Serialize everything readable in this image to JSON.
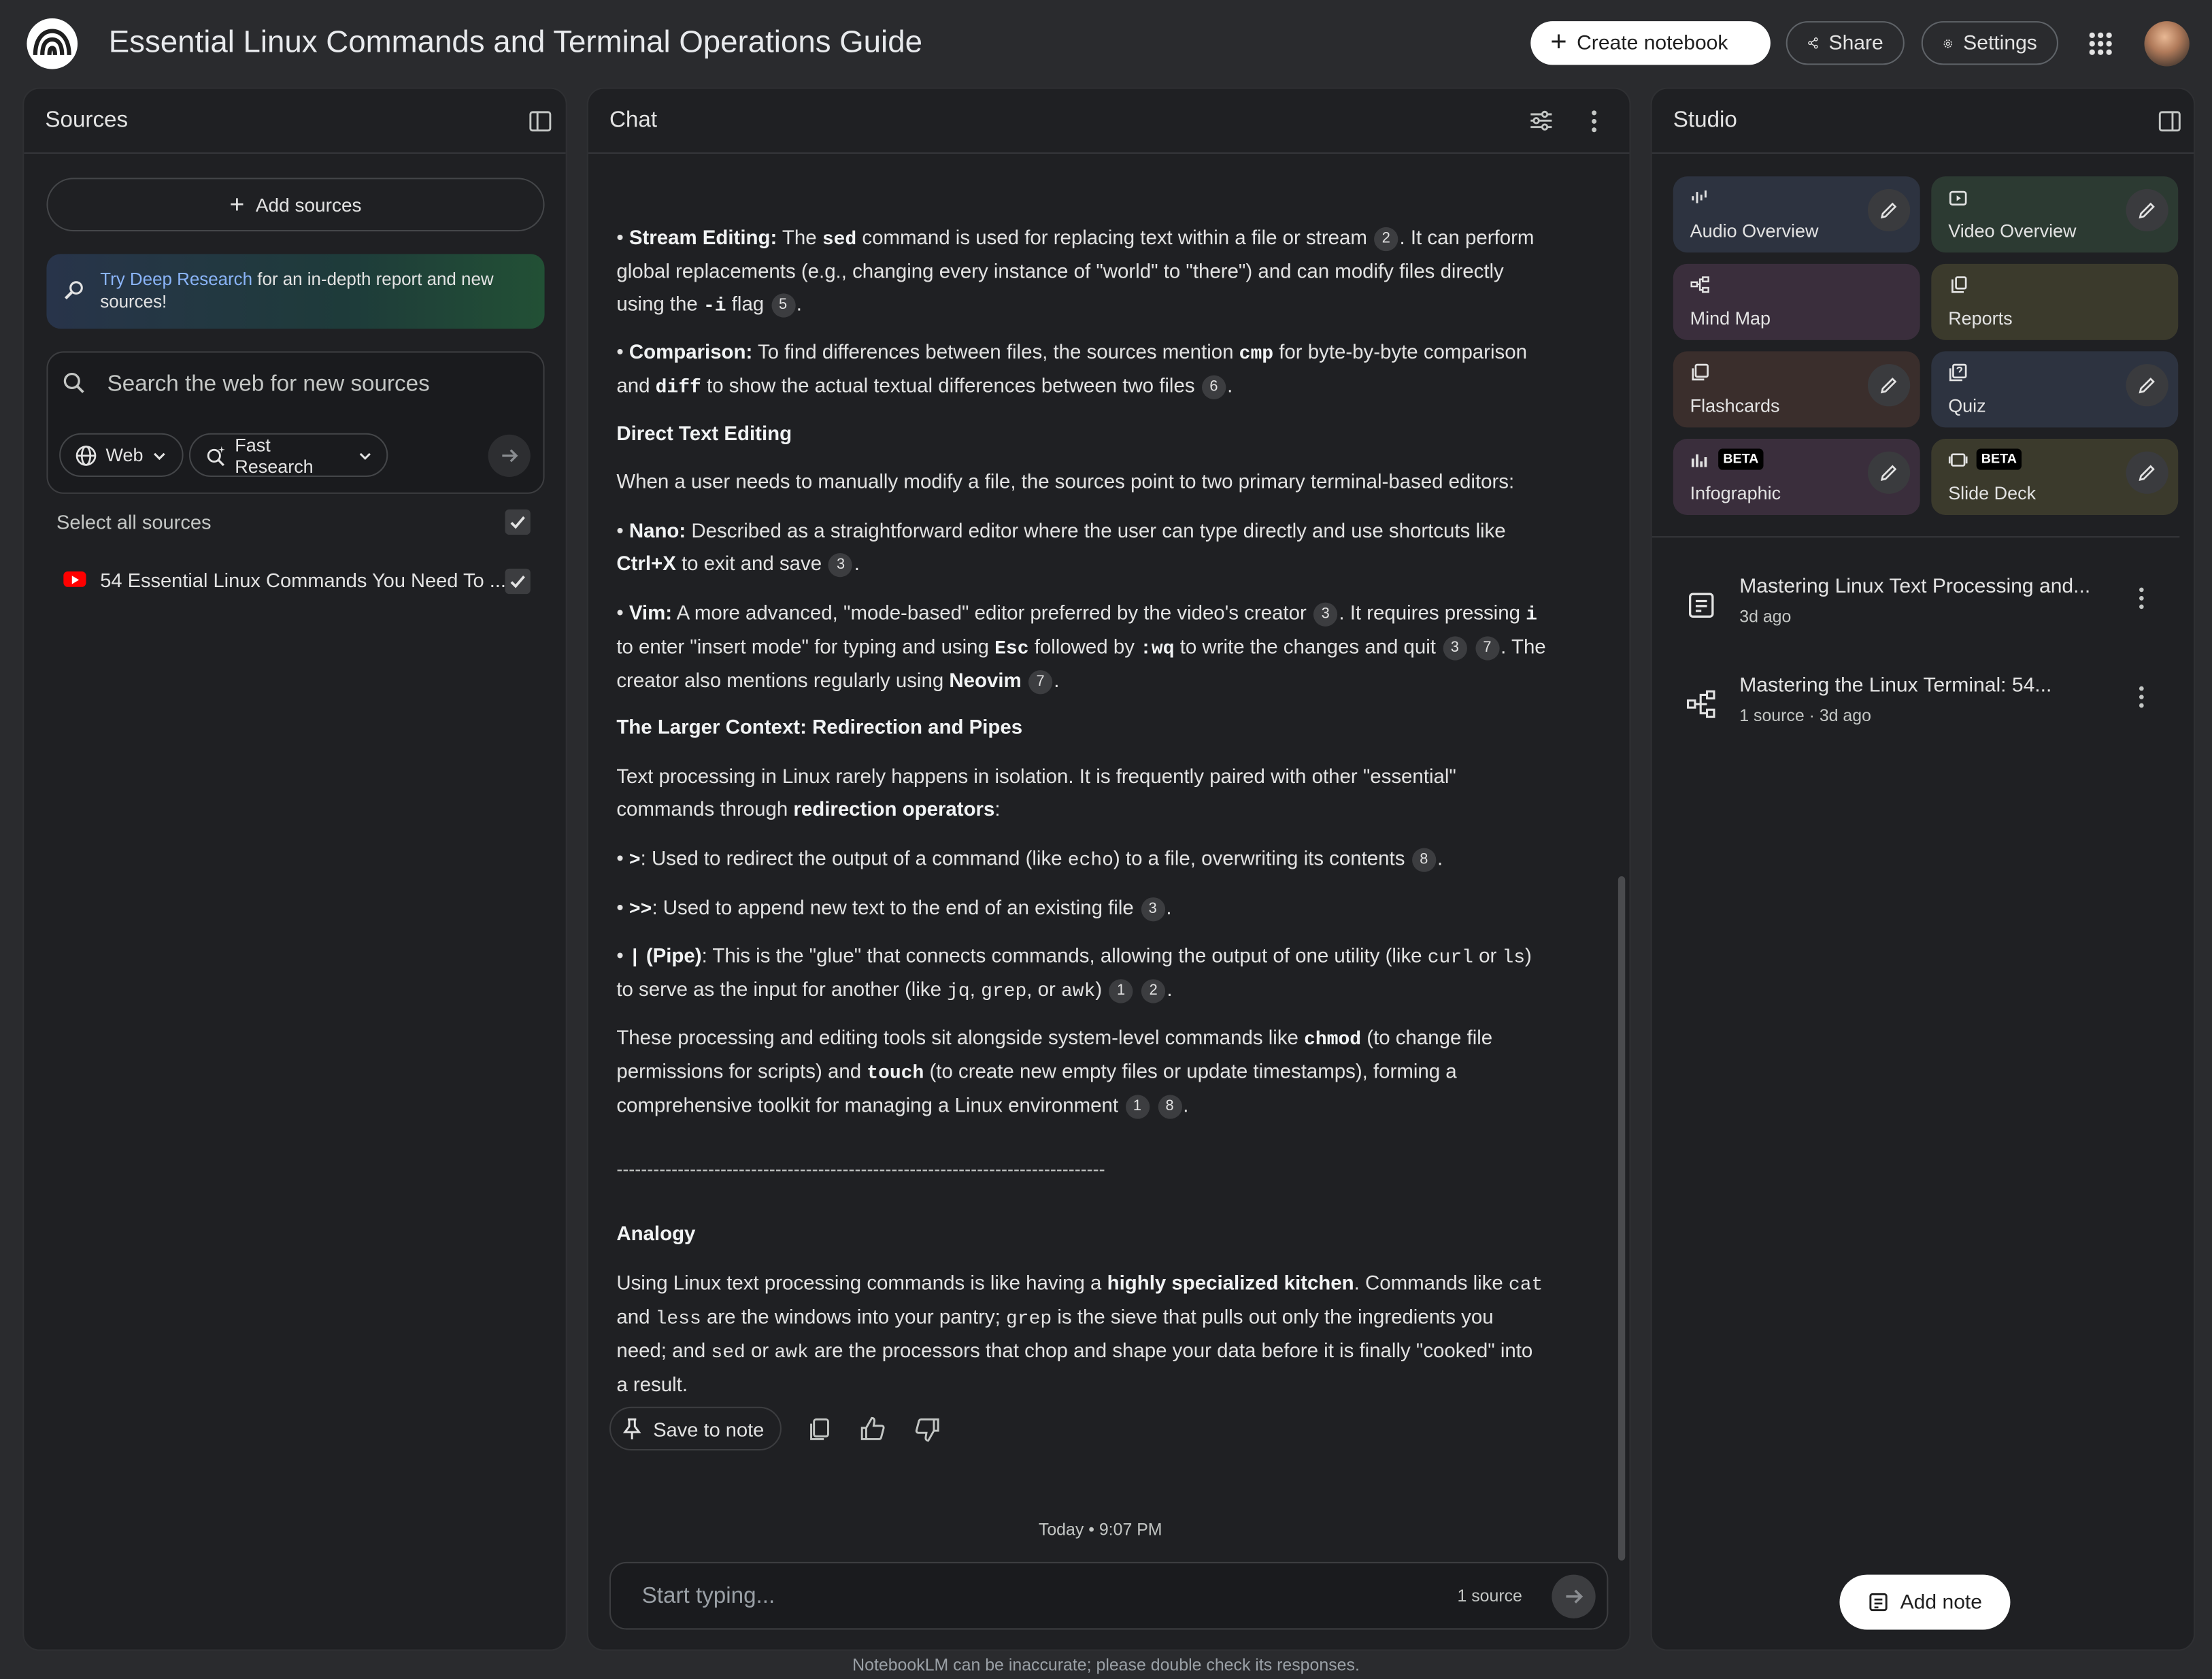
{
  "header": {
    "title": "Essential Linux Commands and Terminal Operations Guide",
    "create_notebook": "Create notebook",
    "share": "Share",
    "settings": "Settings"
  },
  "sources": {
    "title": "Sources",
    "add_sources": "Add sources",
    "deep_research_link": "Try Deep Research",
    "deep_research_rest": " for an in-depth report and new sources!",
    "search_placeholder": "Search the web for new sources",
    "chip_web": "Web",
    "chip_fast": "Fast Research",
    "select_all": "Select all sources",
    "items": [
      {
        "label": "54 Essential Linux Commands You Need To ...",
        "checked": true,
        "icon": "youtube-icon"
      }
    ]
  },
  "chat": {
    "title": "Chat",
    "section_direct": "Direct Text Editing",
    "direct_intro": "When a user needs to manually modify a file, the sources point to two primary terminal-based editors:",
    "section_larger": "The Larger Context: Redirection and Pipes",
    "section_analogy": "Analogy",
    "divider": "--------------------------------------------------------------------------------",
    "save_to_note": "Save to note",
    "timestamp": "Today • 9:07 PM",
    "input_placeholder": "Start typing...",
    "source_count": "1 source"
  },
  "studio": {
    "title": "Studio",
    "tiles": [
      {
        "label": "Audio Overview",
        "icon": "audio-waveform-icon",
        "color": "#2d3340"
      },
      {
        "label": "Video Overview",
        "icon": "video-icon",
        "color": "#2c3a32"
      },
      {
        "label": "Mind Map",
        "icon": "mind-map-icon",
        "color": "#3a2e3c"
      },
      {
        "label": "Reports",
        "icon": "reports-icon",
        "color": "#3b3a2c"
      },
      {
        "label": "Flashcards",
        "icon": "flashcards-icon",
        "color": "#3a2e2c"
      },
      {
        "label": "Quiz",
        "icon": "quiz-icon",
        "color": "#2d3340"
      },
      {
        "label": "Infographic",
        "icon": "infographic-icon",
        "color": "#3a2e3c",
        "badge": "BETA"
      },
      {
        "label": "Slide Deck",
        "icon": "slide-deck-icon",
        "color": "#3b3a2c",
        "badge": "BETA"
      }
    ],
    "notes": [
      {
        "title": "Mastering Linux Text Processing and...",
        "meta": "3d ago",
        "icon": "note-icon"
      },
      {
        "title": "Mastering the Linux Terminal: 54...",
        "meta": "1 source · 3d ago",
        "icon": "mind-map-icon"
      }
    ],
    "add_note": "Add note"
  },
  "footer": "NotebookLM can be inaccurate; please double check its responses."
}
